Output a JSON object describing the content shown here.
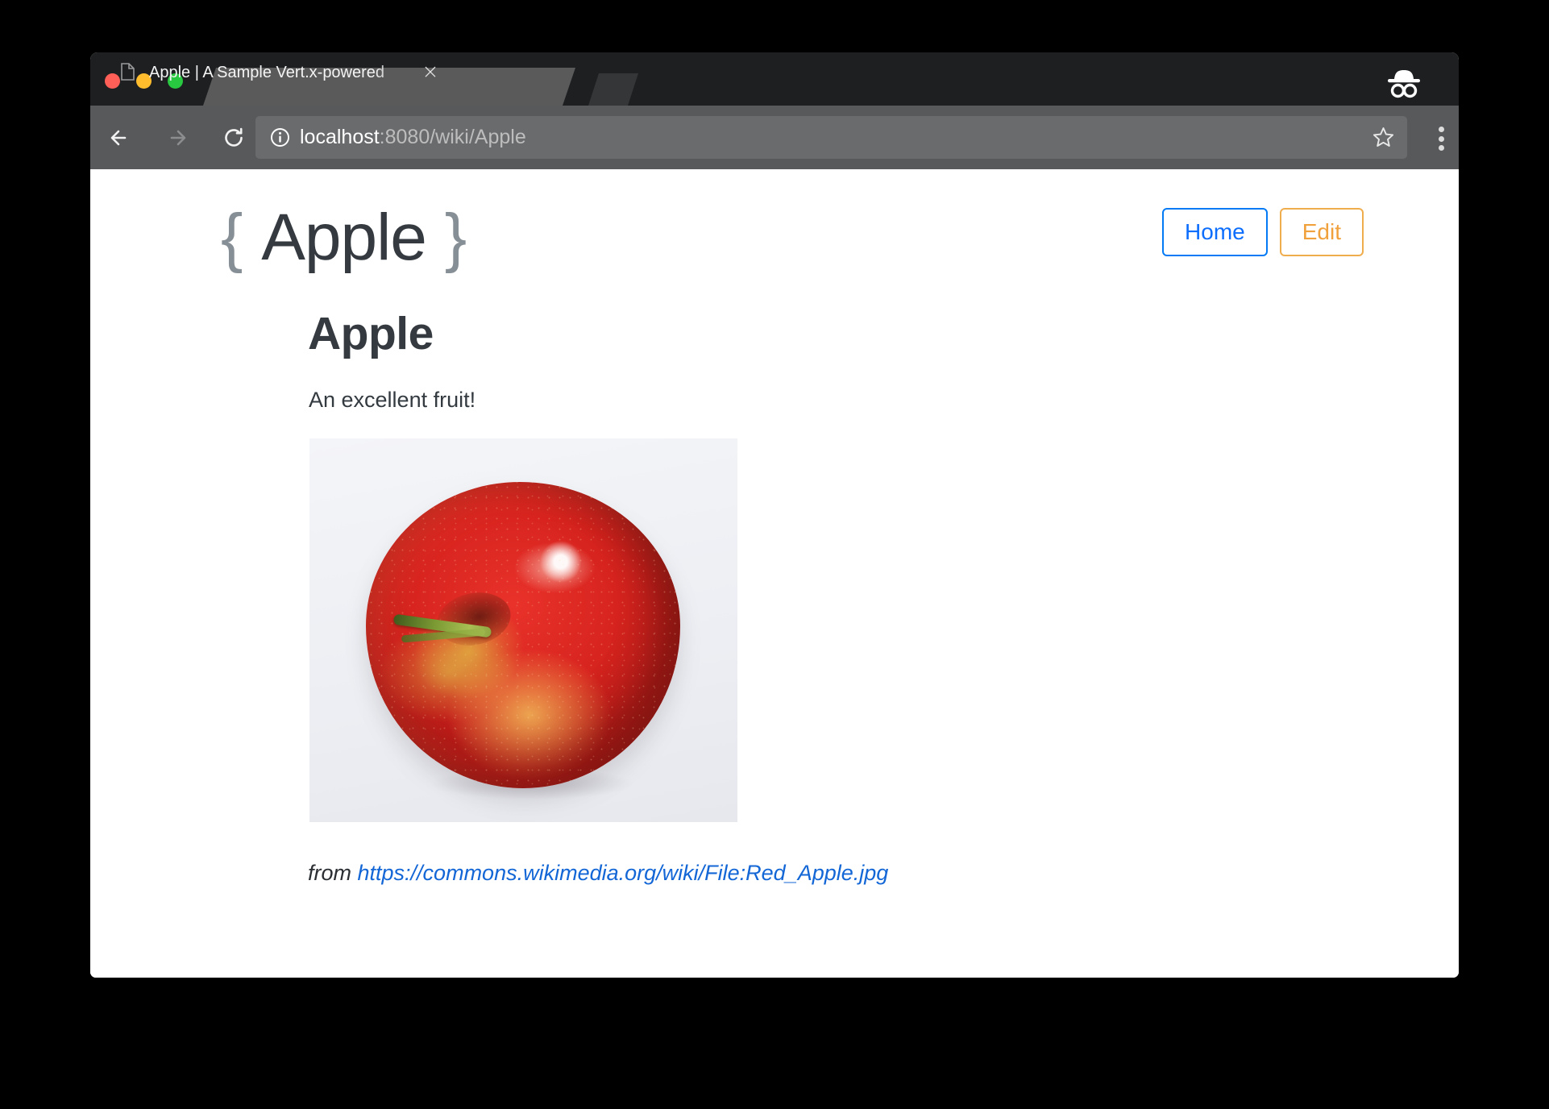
{
  "browser": {
    "window_controls": [
      {
        "name": "close",
        "color": "#ff5f57"
      },
      {
        "name": "minimize",
        "color": "#ffbd2e"
      },
      {
        "name": "maximize",
        "color": "#28c840"
      }
    ],
    "tab": {
      "title": "Apple | A Sample Vert.x-powered",
      "favicon": "document-icon",
      "close_label": "×"
    },
    "new_tab_label": "",
    "incognito_label": "incognito-icon",
    "toolbar": {
      "back": "←",
      "forward": "→",
      "reload": "↻",
      "url_host": "localhost",
      "url_path": ":8080/wiki/Apple",
      "url_full": "localhost:8080/wiki/Apple",
      "info_icon": "info-circle-icon",
      "bookmark_icon": "star-icon",
      "menu_icon": "three-dots-icon"
    }
  },
  "page": {
    "logo": {
      "brace_open": "{",
      "name": "Apple",
      "brace_close": "}"
    },
    "actions": {
      "home_label": "Home",
      "edit_label": "Edit"
    },
    "article": {
      "title": "Apple",
      "body": "An excellent fruit!",
      "image_alt": "red-apple-photo"
    },
    "attribution": {
      "prefix": "from ",
      "link_text": "https://commons.wikimedia.org/wiki/File:Red_Apple.jpg"
    }
  },
  "colors": {
    "titlebar": "#1d1f21",
    "toolbar": "#58595b",
    "tab_active": "#5a5a5a",
    "home_accent": "#0d6efd",
    "edit_accent": "#f0a13c",
    "link": "#1366d6",
    "heading": "#343a40",
    "brace": "#868e96",
    "image_bg": "#f1f2f6"
  }
}
